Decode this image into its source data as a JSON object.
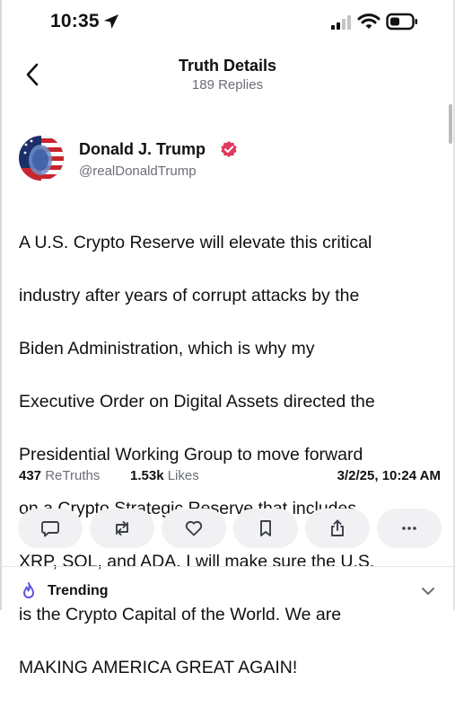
{
  "status_bar": {
    "time": "10:35"
  },
  "nav": {
    "title": "Truth Details",
    "subtitle": "189 Replies"
  },
  "post": {
    "author": "Donald J. Trump",
    "handle": "@realDonaldTrump",
    "verified": true,
    "lines": [
      "A U.S. Crypto Reserve will elevate this critical",
      "industry after years of corrupt attacks by the",
      "Biden Administration, which is why my",
      "Executive Order on Digital Assets directed the",
      "Presidential Working Group to move forward",
      "on a Crypto Strategic Reserve that includes",
      "XRP, SOL, and ADA. I will make sure the U.S.",
      "is the Crypto Capital of the World. We are",
      "MAKING AMERICA GREAT AGAIN!"
    ],
    "retruths_count": "437",
    "retruths_label": "ReTruths",
    "likes_count": "1.53k",
    "likes_label": "Likes",
    "timestamp": "3/2/25, 10:24 AM"
  },
  "actions": [
    "reply-icon",
    "retruth-icon",
    "heart-icon",
    "bookmark-icon",
    "share-icon",
    "more-icon"
  ],
  "trending": {
    "label": "Trending"
  },
  "colors": {
    "verified_badge": "#e03a5e",
    "trending_icon": "#5b4fe0",
    "muted_text": "#6b6e7a",
    "action_bg": "#f1f1f4"
  }
}
